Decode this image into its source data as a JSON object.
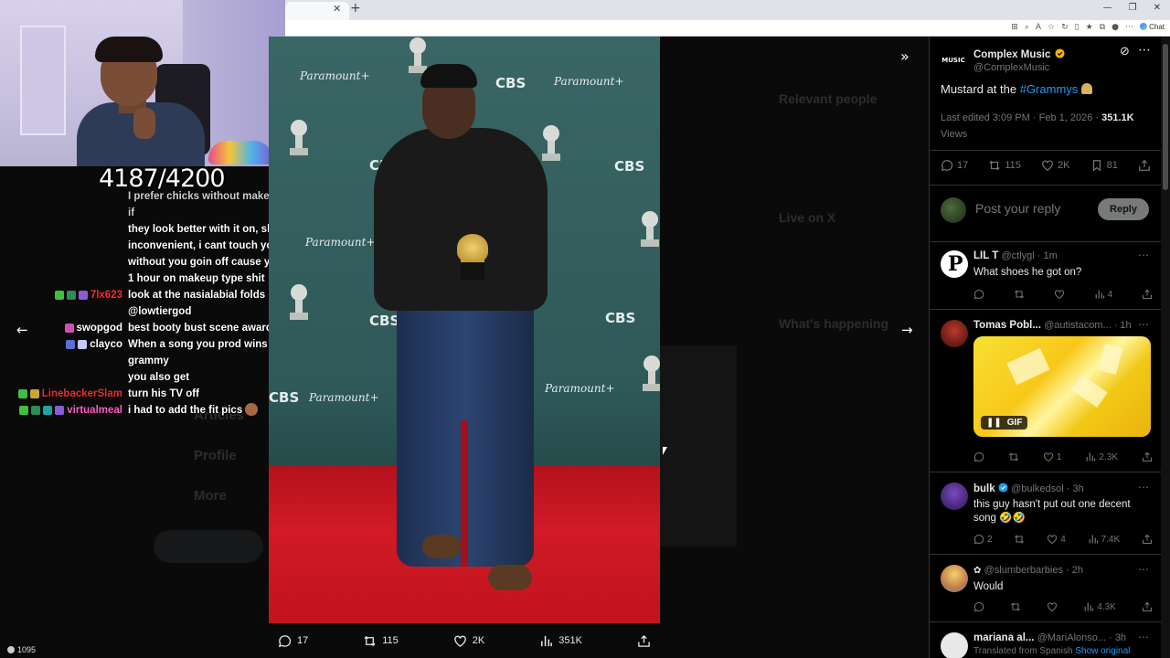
{
  "stream": {
    "sub_counter": "4187/4200",
    "viewer_count": "1095",
    "chat": [
      {
        "user": "",
        "color": "#9ab",
        "badges": [],
        "msg": "I prefer chicks without makeup even if",
        "faded": true
      },
      {
        "user": "",
        "color": "#fff",
        "badges": [],
        "msg": "they look better with it on, shits"
      },
      {
        "user": "",
        "color": "#fff",
        "badges": [],
        "msg": "inconvenient, i cant touch your face"
      },
      {
        "user": "",
        "color": "#fff",
        "badges": [],
        "msg": "without you goin off cause you spend"
      },
      {
        "user": "",
        "color": "#fff",
        "badges": [],
        "msg": "1 hour on makeup type shit"
      },
      {
        "user": "7lx623",
        "color": "#ff2a2a",
        "badges": [
          "#3fbf3f",
          "#2e8b57",
          "#8a5cd6"
        ],
        "msg": "look at the nasialabial folds lmao"
      },
      {
        "user": "",
        "color": "#fff",
        "badges": [],
        "msg": "@lowtiergod"
      },
      {
        "user": "swopgod",
        "color": "#ffffff",
        "badges": [
          "#d14fb2"
        ],
        "msg": "best booty bust scene award"
      },
      {
        "user": "clayco",
        "color": "#ffffff",
        "badges": [
          "#5a6fd6",
          "#c8c8ff"
        ],
        "msg": "When a song you prod wins a grammy"
      },
      {
        "user": "",
        "color": "#fff",
        "badges": [],
        "msg": "you also get"
      },
      {
        "user": "LinebackerSlam",
        "color": "#e0312f",
        "badges": [
          "#3fbf3f",
          "#c8a630"
        ],
        "msg": "turn his TV off"
      },
      {
        "user": "virtualmeal",
        "color": "#ff5bc6",
        "badges": [
          "#3fbf3f",
          "#2e8b57",
          "#1fa3a3",
          "#8a5cd6"
        ],
        "msg": "i had to add the fit pics",
        "emote": true
      }
    ]
  },
  "viewer": {
    "actions": {
      "replies": "17",
      "reposts": "115",
      "likes": "2K",
      "views": "351K"
    },
    "backdrop": {
      "cbs": "CBS",
      "paramount": "Paramount+"
    }
  },
  "post": {
    "name": "Complex Music",
    "handle": "@ComplexMusic",
    "text_prefix": "Mustard at the ",
    "hashtag": "#Grammys",
    "edited": "Last edited 3:09 PM · Feb 1, 2026 · ",
    "views_count": "351.1K",
    "views_label": "Views",
    "stats": {
      "replies": "17",
      "reposts": "115",
      "likes": "2K",
      "bookmarks": "81"
    },
    "reply_placeholder": "Post your reply",
    "reply_button": "Reply"
  },
  "replies": [
    {
      "name": "LIL T",
      "handle": "@ctlygl · 1m",
      "text": "What shoes he got on?",
      "likes": "",
      "views": "4",
      "reposts": "",
      "comments": ""
    },
    {
      "name": "Tomas Pobl...",
      "handle": "@autistacom... · 1h",
      "text": "",
      "gif_label": "GIF",
      "likes": "1",
      "views": "2.3K",
      "reposts": "",
      "comments": ""
    },
    {
      "name": "bulk",
      "handle": "@bulkedsol · 3h",
      "text": "this guy hasn't put out one decent song 🤣🤣",
      "comments": "2",
      "reposts": "",
      "likes": "4",
      "views": "7.4K"
    },
    {
      "name": "",
      "handle": "@slumberbarbies · 2h",
      "text": "Would",
      "comments": "",
      "reposts": "",
      "likes": "",
      "views": "4.3K"
    },
    {
      "name": "mariana al...",
      "handle": "@MariAlonso... · 3h",
      "translated": "Translated from Spanish",
      "show_original": "Show original"
    }
  ],
  "colors": {
    "accent": "#1d9bf0",
    "verified": "#f4b400",
    "bg": "#000000",
    "muted": "#71767b"
  }
}
